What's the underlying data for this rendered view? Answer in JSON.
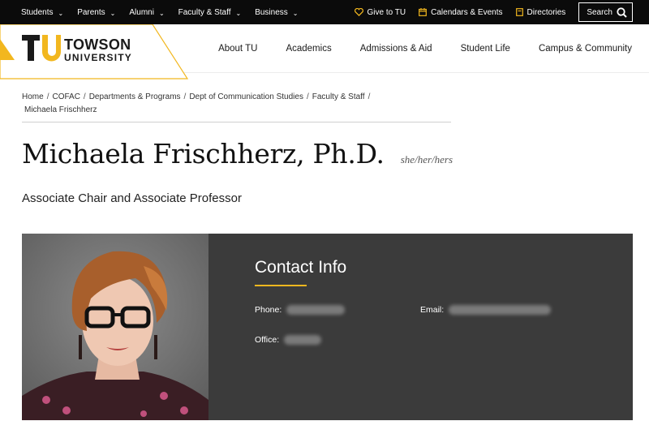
{
  "utility": {
    "left_items": [
      "Students",
      "Parents",
      "Alumni",
      "Faculty & Staff",
      "Business"
    ],
    "give_label": "Give to TU",
    "calendars_label": "Calendars & Events",
    "directories_label": "Directories",
    "search_label": "Search"
  },
  "logo": {
    "line1": "TOWSON",
    "line2": "UNIVERSITY",
    "brand_gold": "#f2b71f",
    "brand_black": "#1a1a1a"
  },
  "nav": {
    "items": [
      "About TU",
      "Academics",
      "Admissions & Aid",
      "Student Life",
      "Campus & Community"
    ]
  },
  "breadcrumb": {
    "items": [
      "Home",
      "COFAC",
      "Departments & Programs",
      "Dept of Communication Studies",
      "Faculty & Staff"
    ],
    "current": "Michaela Frischherz",
    "separator": "/"
  },
  "profile": {
    "name": "Michaela Frischherz, Ph.D.",
    "pronouns": "she/her/hers",
    "title": "Associate Chair and Associate Professor"
  },
  "contact": {
    "heading": "Contact Info",
    "phone_label": "Phone:",
    "email_label": "Email:",
    "office_label": "Office:"
  },
  "colors": {
    "accent": "#f2b71f",
    "card_bg": "#3b3b3b",
    "utility_bg": "#0b0b0b"
  }
}
